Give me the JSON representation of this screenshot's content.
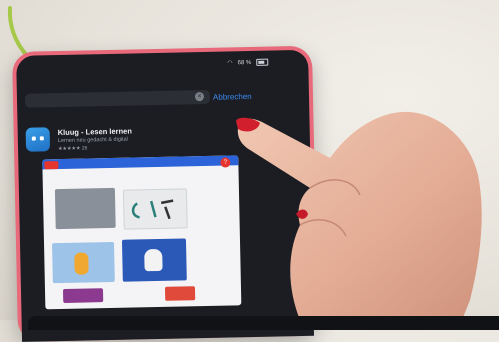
{
  "status": {
    "battery": "68 %"
  },
  "search": {
    "cancel_label": "Abbrechen"
  },
  "app": {
    "name": "Kluug - Lesen lernen",
    "subtitle": "Lernen neu gedacht & digital",
    "rating": "★★★★★ 26"
  },
  "colors": {
    "ipad_case": "#e8697a",
    "screen": "#1b1d22",
    "link": "#3d8bf2",
    "arrow": "#a6c94a",
    "preview_header": "#2c63d8"
  }
}
